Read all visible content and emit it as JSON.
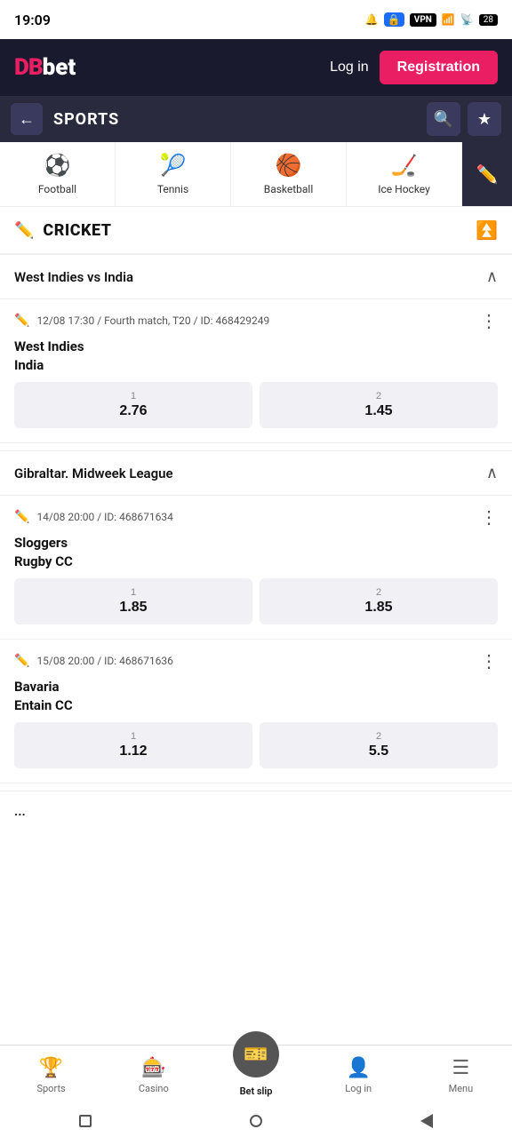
{
  "statusBar": {
    "time": "19:09",
    "vpn": "VPN",
    "battery": "28"
  },
  "header": {
    "logo_db": "DB",
    "logo_bet": "bet",
    "login_label": "Log in",
    "register_label": "Registration"
  },
  "sportsNav": {
    "title": "SPORTS",
    "back_arrow": "←",
    "search_icon": "🔍",
    "star_icon": "★"
  },
  "categories": [
    {
      "label": "Football",
      "icon": "⚽"
    },
    {
      "label": "Tennis",
      "icon": "🎾"
    },
    {
      "label": "Basketball",
      "icon": "🏀"
    },
    {
      "label": "Ice Hockey",
      "icon": "🏒"
    }
  ],
  "sectionTitle": "CRICKET",
  "matchGroups": [
    {
      "title": "West Indies vs India",
      "matches": [
        {
          "meta": "12/08 17:30 / Fourth match, T20 / ID: 468429249",
          "team1": "West Indies",
          "team2": "India",
          "odds": [
            {
              "label": "1",
              "value": "2.76"
            },
            {
              "label": "2",
              "value": "1.45"
            }
          ]
        }
      ]
    },
    {
      "title": "Gibraltar. Midweek League",
      "matches": [
        {
          "meta": "14/08 20:00 / ID: 468671634",
          "team1": "Sloggers",
          "team2": "Rugby CC",
          "odds": [
            {
              "label": "1",
              "value": "1.85"
            },
            {
              "label": "2",
              "value": "1.85"
            }
          ]
        },
        {
          "meta": "15/08 20:00 / ID: 468671636",
          "team1": "Bavaria",
          "team2": "Entain CC",
          "odds": [
            {
              "label": "1",
              "value": "1.12"
            },
            {
              "label": "2",
              "value": "5.5"
            }
          ]
        }
      ]
    }
  ],
  "bottomNav": [
    {
      "label": "Sports",
      "icon": "🏆",
      "active": false
    },
    {
      "label": "Casino",
      "icon": "🎰",
      "active": false
    },
    {
      "label": "Bet slip",
      "icon": "🎫",
      "active": true,
      "center": true
    },
    {
      "label": "Log in",
      "icon": "👤",
      "active": false
    },
    {
      "label": "Menu",
      "icon": "☰",
      "active": false
    }
  ]
}
